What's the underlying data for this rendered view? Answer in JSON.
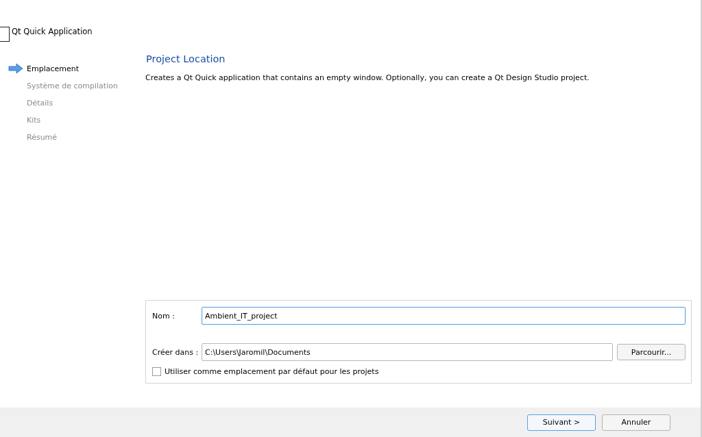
{
  "window": {
    "title": "Qt Quick Application"
  },
  "steps": [
    {
      "label": "Emplacement",
      "selected": true
    },
    {
      "label": "Système de compilation",
      "selected": false
    },
    {
      "label": "Détails",
      "selected": false
    },
    {
      "label": "Kits",
      "selected": false
    },
    {
      "label": "Résumé",
      "selected": false
    }
  ],
  "page": {
    "title": "Project Location",
    "description": "Creates a Qt Quick application that contains an empty window. Optionally, you can create a Qt Design Studio project."
  },
  "form": {
    "name_label": "Nom :",
    "name_value": "Ambient_IT_project",
    "dir_label": "Créer dans :",
    "dir_value": "C:\\Users\\Jaromil\\Documents",
    "browse": "Parcourir...",
    "default_checkbox": {
      "label": "Utiliser comme emplacement par défaut pour les projets",
      "checked": false
    }
  },
  "buttons": [
    {
      "label": "Suivant >",
      "default": true
    },
    {
      "label": "Annuler",
      "default": false
    }
  ]
}
